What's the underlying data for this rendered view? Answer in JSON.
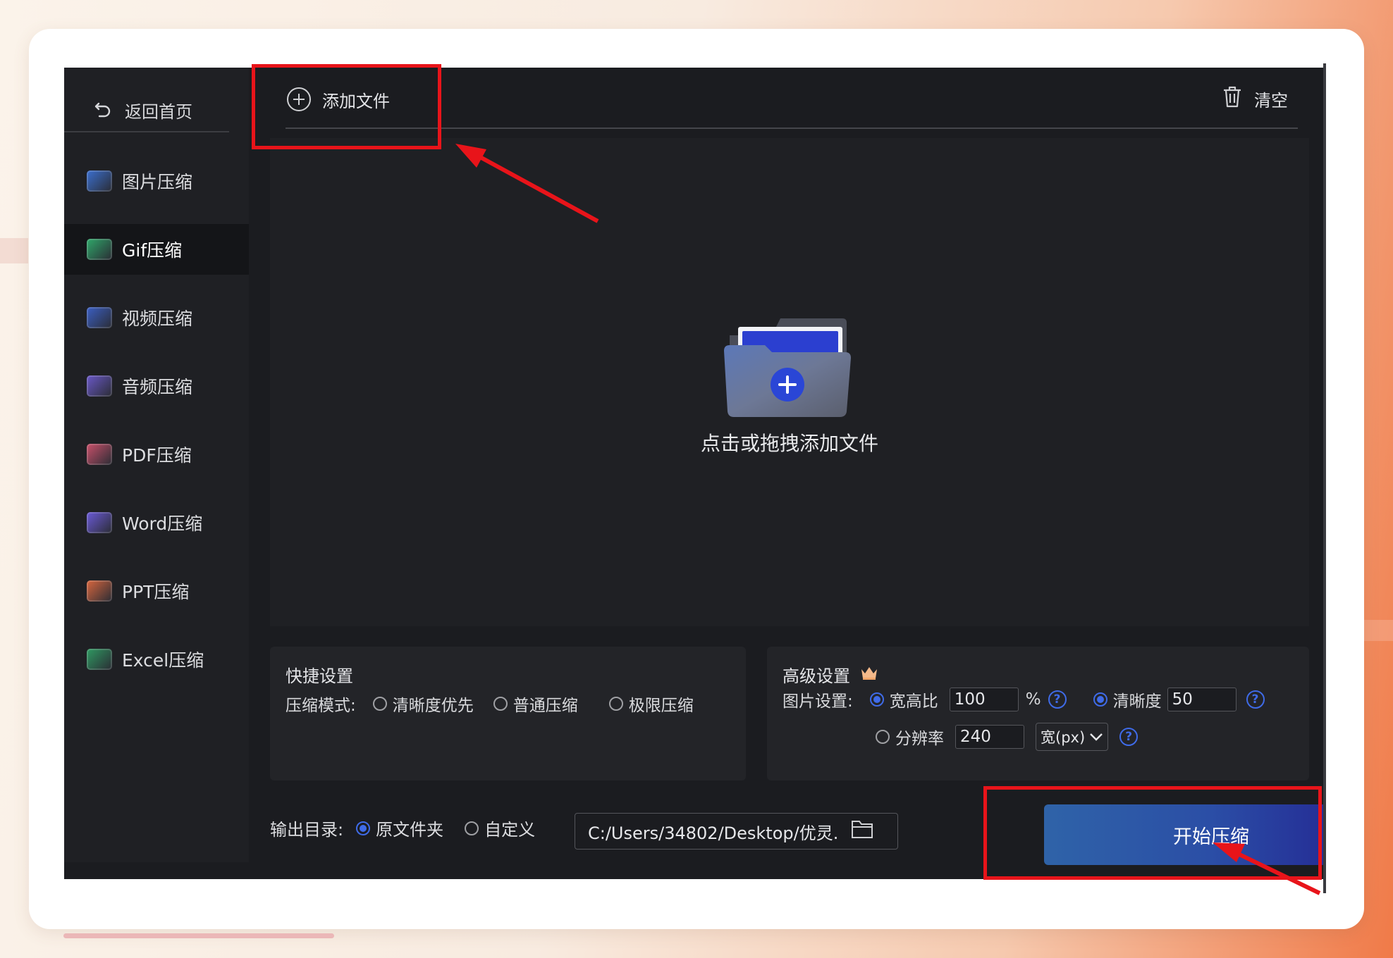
{
  "sidebar": {
    "back_label": "返回首页",
    "items": [
      {
        "label": "图片压缩",
        "icon": "image-icon",
        "color": "#3b6fd0"
      },
      {
        "label": "Gif压缩",
        "icon": "gif-icon",
        "color": "#2fa86a"
      },
      {
        "label": "视频压缩",
        "icon": "video-icon",
        "color": "#3b5fc4"
      },
      {
        "label": "音频压缩",
        "icon": "audio-icon",
        "color": "#6a58c8"
      },
      {
        "label": "PDF压缩",
        "icon": "pdf-icon",
        "color": "#c9506a"
      },
      {
        "label": "Word压缩",
        "icon": "word-icon",
        "color": "#6b5ad8"
      },
      {
        "label": "PPT压缩",
        "icon": "ppt-icon",
        "color": "#d8663e"
      },
      {
        "label": "Excel压缩",
        "icon": "excel-icon",
        "color": "#2f9a62"
      }
    ],
    "active_index": 1
  },
  "toolbar": {
    "add_file_label": "添加文件",
    "clear_label": "清空"
  },
  "drop_zone": {
    "label": "点击或拖拽添加文件"
  },
  "quick_settings": {
    "title": "快捷设置",
    "mode_label": "压缩模式:",
    "options": [
      "清晰度优先",
      "普通压缩",
      "极限压缩"
    ]
  },
  "advanced_settings": {
    "title": "高级设置",
    "image_label": "图片设置:",
    "ratio_label": "宽高比",
    "ratio_value": "100",
    "percent": "%",
    "clarity_label": "清晰度",
    "clarity_value": "50",
    "resolution_label": "分辨率",
    "resolution_value": "240",
    "resolution_unit": "宽(px)",
    "help_symbol": "?"
  },
  "output": {
    "label": "输出目录:",
    "option_original": "原文件夹",
    "option_custom": "自定义",
    "path": "C:/Users/34802/Desktop/优灵."
  },
  "start_button": "开始压缩",
  "colors": {
    "accent": "#3f6be8",
    "annotation": "#e8141a",
    "background": "#1b1c20"
  }
}
